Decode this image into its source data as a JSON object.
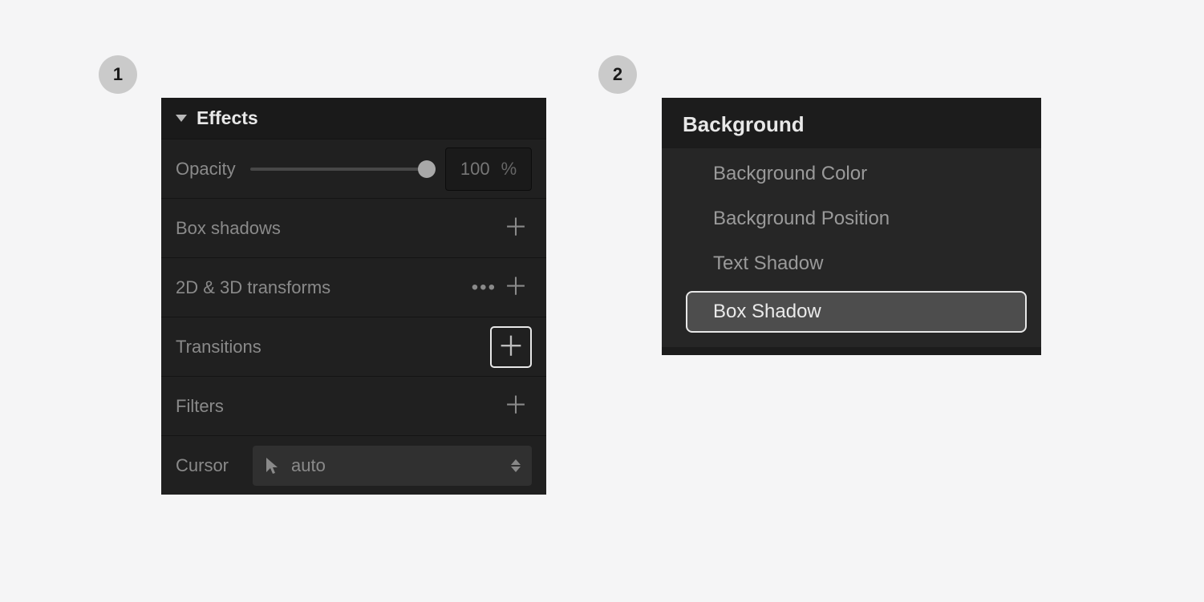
{
  "steps": {
    "one": "1",
    "two": "2"
  },
  "panel1": {
    "title": "Effects",
    "opacity": {
      "label": "Opacity",
      "value": "100",
      "unit": "%"
    },
    "rows": {
      "boxshadows": "Box shadows",
      "transforms": "2D & 3D transforms",
      "transitions": "Transitions",
      "filters": "Filters",
      "cursor_label": "Cursor",
      "cursor_value": "auto"
    }
  },
  "panel2": {
    "title": "Background",
    "items": [
      "Background Color",
      "Background Position",
      "Text Shadow",
      "Box Shadow"
    ],
    "selected_index": 3
  }
}
